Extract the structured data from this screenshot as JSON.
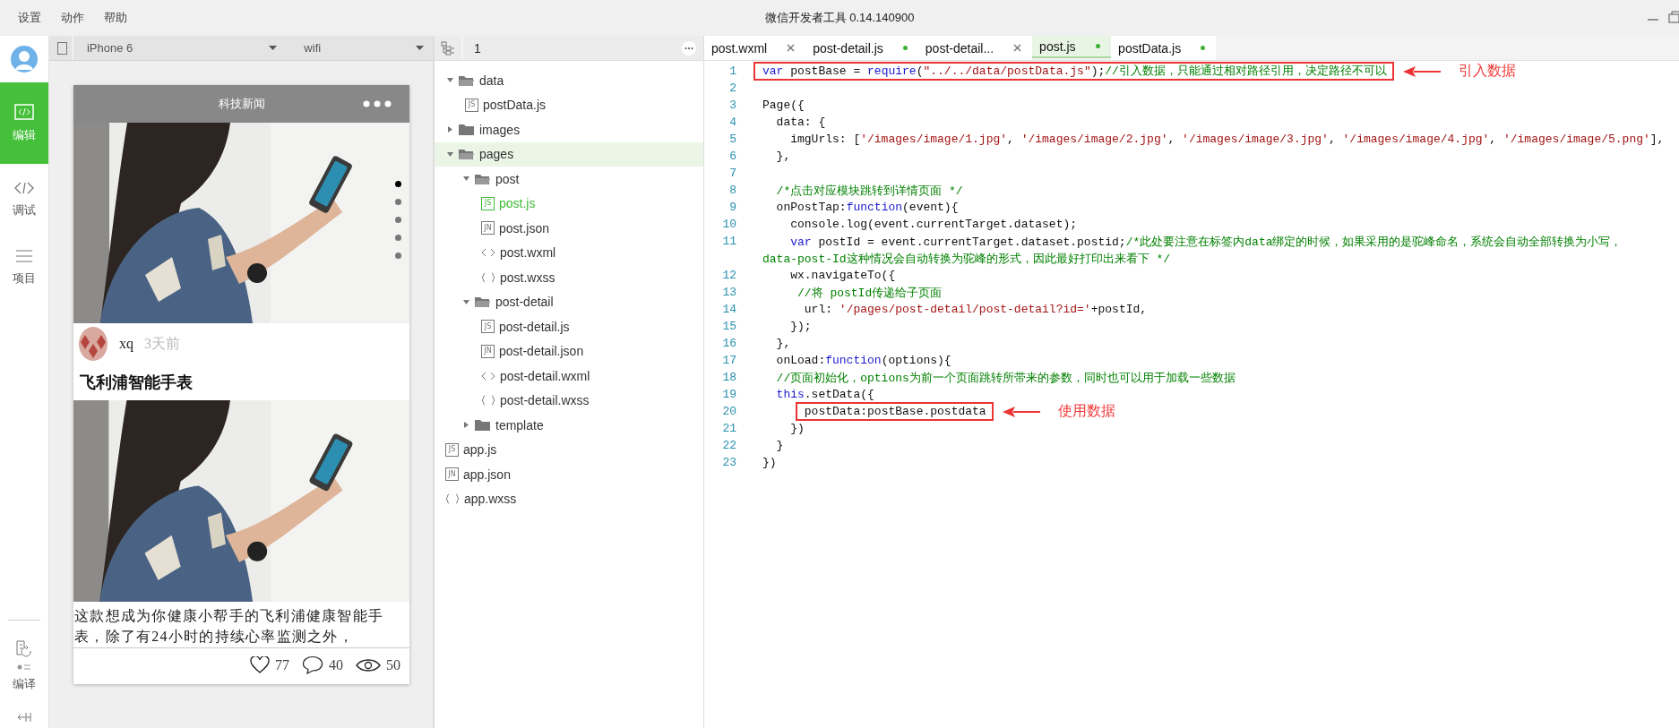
{
  "menu": [
    {
      "label": "设置"
    },
    {
      "label": "动作"
    },
    {
      "label": "帮助"
    }
  ],
  "window": {
    "title": "微信开发者工具 0.14.140900"
  },
  "sidebar": {
    "items": [
      {
        "label": "编辑",
        "kind": "edit",
        "selected": true
      },
      {
        "label": "调试",
        "kind": "debug",
        "selected": false
      },
      {
        "label": "项目",
        "kind": "project",
        "selected": false
      }
    ],
    "compile": {
      "label": "编译"
    }
  },
  "simulator": {
    "device": "iPhone 6",
    "network": "wifi",
    "nav_title": "科技新闻",
    "swiper_dots": [
      {
        "selected": true
      },
      {
        "selected": false
      },
      {
        "selected": false
      },
      {
        "selected": false
      },
      {
        "selected": false
      }
    ],
    "post": {
      "author": "xq",
      "date": "3天前",
      "title": "飞利浦智能手表",
      "content": "这款想成为你健康小帮手的飞利浦健康智能手表，除了有24小时的持续心率监测之外，",
      "likes": "77",
      "comments": "40",
      "views": "50"
    }
  },
  "file_tree": {
    "header": "1",
    "items": [
      {
        "name": "data",
        "kind": "folder",
        "expanded": true,
        "selected": false,
        "children": [
          {
            "name": "postData.js",
            "kind": "js",
            "badge": "JS",
            "open": false,
            "selected": false
          }
        ]
      },
      {
        "name": "images",
        "kind": "folder",
        "expanded": false,
        "selected": false
      },
      {
        "name": "pages",
        "kind": "folder",
        "expanded": true,
        "selected": true,
        "children": [
          {
            "name": "post",
            "kind": "folder",
            "expanded": true,
            "selected": false,
            "children": [
              {
                "name": "post.js",
                "kind": "js",
                "badge": "JS",
                "open": true,
                "selected": false
              },
              {
                "name": "post.json",
                "kind": "json",
                "badge": "JN",
                "open": false,
                "selected": false
              },
              {
                "name": "post.wxml",
                "kind": "wxml",
                "open": false,
                "selected": false
              },
              {
                "name": "post.wxss",
                "kind": "wxss",
                "open": false,
                "selected": false
              }
            ]
          },
          {
            "name": "post-detail",
            "kind": "folder",
            "expanded": true,
            "selected": false,
            "children": [
              {
                "name": "post-detail.js",
                "kind": "js",
                "badge": "JS",
                "open": false,
                "selected": false
              },
              {
                "name": "post-detail.json",
                "kind": "json",
                "badge": "JN",
                "open": false,
                "selected": false
              },
              {
                "name": "post-detail.wxml",
                "kind": "wxml",
                "open": false,
                "selected": false
              },
              {
                "name": "post-detail.wxss",
                "kind": "wxss",
                "open": false,
                "selected": false
              }
            ]
          },
          {
            "name": "template",
            "kind": "folder",
            "expanded": false,
            "selected": false
          }
        ]
      },
      {
        "name": "app.js",
        "kind": "js",
        "badge": "JS",
        "open": false,
        "selected": false
      },
      {
        "name": "app.json",
        "kind": "json",
        "badge": "JN",
        "open": false,
        "selected": false
      },
      {
        "name": "app.wxss",
        "kind": "wxss",
        "open": false,
        "selected": false
      }
    ]
  },
  "editor": {
    "tabs": [
      {
        "label": "post.wxml",
        "modified": false,
        "selected": false
      },
      {
        "label": "post-detail.js",
        "modified": true,
        "selected": false
      },
      {
        "label": "post-detail...",
        "modified": false,
        "selected": false
      },
      {
        "label": "post.js",
        "modified": true,
        "selected": true
      },
      {
        "label": "postData.js",
        "modified": true,
        "selected": false
      }
    ],
    "lines": [
      {
        "number": "1",
        "boxed": true,
        "annotation": "引入数据",
        "segments": [
          {
            "kind": "keyword",
            "text": "var"
          },
          {
            "kind": "plain",
            "text": " postBase = "
          },
          {
            "kind": "keyword",
            "text": "require"
          },
          {
            "kind": "plain",
            "text": "("
          },
          {
            "kind": "string",
            "text": "\"../../data/postData.js\""
          },
          {
            "kind": "plain",
            "text": ");"
          },
          {
            "kind": "comment",
            "text": "//引入数据，只能通过相对路径引用，决定路径不可以"
          }
        ]
      },
      {
        "number": "2"
      },
      {
        "number": "3",
        "boxed": false,
        "segments": [
          {
            "kind": "plain",
            "text": "Page({"
          }
        ]
      },
      {
        "number": "4",
        "boxed": false,
        "segments": [
          {
            "kind": "plain",
            "text": "  data: {"
          }
        ]
      },
      {
        "number": "5",
        "boxed": false,
        "segments": [
          {
            "kind": "plain",
            "text": "    imgUrls: ["
          },
          {
            "kind": "string",
            "text": "'/images/image/1.jpg'"
          },
          {
            "kind": "plain",
            "text": ", "
          },
          {
            "kind": "string",
            "text": "'/images/image/2.jpg'"
          },
          {
            "kind": "plain",
            "text": ", "
          },
          {
            "kind": "string",
            "text": "'/images/image/3.jpg'"
          },
          {
            "kind": "plain",
            "text": ", "
          },
          {
            "kind": "string",
            "text": "'/images/image/4.jpg'"
          },
          {
            "kind": "plain",
            "text": ", "
          },
          {
            "kind": "string",
            "text": "'/images/image/5.png'"
          },
          {
            "kind": "plain",
            "text": "],"
          }
        ]
      },
      {
        "number": "6",
        "boxed": false,
        "segments": [
          {
            "kind": "plain",
            "text": "  },"
          }
        ]
      },
      {
        "number": "7"
      },
      {
        "number": "8",
        "boxed": false,
        "segments": [
          {
            "kind": "comment",
            "text": "  /*点击对应模块跳转到详情页面 */"
          }
        ]
      },
      {
        "number": "9",
        "boxed": false,
        "segments": [
          {
            "kind": "plain",
            "text": "  onPostTap:"
          },
          {
            "kind": "keyword",
            "text": "function"
          },
          {
            "kind": "plain",
            "text": "(event){"
          }
        ]
      },
      {
        "number": "10",
        "boxed": false,
        "segments": [
          {
            "kind": "plain",
            "text": "    console.log(event.currentTarget.dataset);"
          }
        ]
      },
      {
        "number": "11",
        "boxed": false,
        "segments": [
          {
            "kind": "keyword",
            "text": "    var"
          },
          {
            "kind": "plain",
            "text": " postId = event.currentTarget.dataset.postid;"
          },
          {
            "kind": "comment",
            "text": "/*此处要注意在标签内data绑定的时候，如果采用的是驼峰命名，系统会自动全部转换为小写，"
          }
        ],
        "wrap": [
          {
            "kind": "comment",
            "text": "data-post-Id这种情况会自动转换为驼峰的形式，因此最好打印出来看下 */"
          }
        ]
      },
      {
        "number": "12",
        "boxed": false,
        "segments": [
          {
            "kind": "plain",
            "text": "    wx.navigateTo({"
          }
        ]
      },
      {
        "number": "13",
        "boxed": false,
        "segments": [
          {
            "kind": "comment",
            "text": "     //将 postId传递给子页面"
          }
        ]
      },
      {
        "number": "14",
        "boxed": false,
        "segments": [
          {
            "kind": "plain",
            "text": "      url: "
          },
          {
            "kind": "string",
            "text": "'/pages/post-detail/post-detail?id='"
          },
          {
            "kind": "plain",
            "text": "+postId,"
          }
        ]
      },
      {
        "number": "15",
        "boxed": false,
        "segments": [
          {
            "kind": "plain",
            "text": "    });"
          }
        ]
      },
      {
        "number": "16",
        "boxed": false,
        "segments": [
          {
            "kind": "plain",
            "text": "  },"
          }
        ]
      },
      {
        "number": "17",
        "boxed": false,
        "segments": [
          {
            "kind": "plain",
            "text": "  onLoad:"
          },
          {
            "kind": "keyword",
            "text": "function"
          },
          {
            "kind": "plain",
            "text": "(options){"
          }
        ]
      },
      {
        "number": "18",
        "boxed": false,
        "segments": [
          {
            "kind": "comment",
            "text": "  //页面初始化，options为前一个页面跳转所带来的参数，同时也可以用于加载一些数据"
          }
        ]
      },
      {
        "number": "19",
        "boxed": false,
        "segments": [
          {
            "kind": "keyword",
            "text": "  this"
          },
          {
            "kind": "plain",
            "text": ".setData({"
          }
        ]
      },
      {
        "number": "20",
        "boxed": true,
        "annotation": "使用数据",
        "segments": [
          {
            "kind": "plain",
            "text": "      postData:postBase.postdata"
          }
        ]
      },
      {
        "number": "21",
        "boxed": false,
        "segments": [
          {
            "kind": "plain",
            "text": "    })"
          }
        ]
      },
      {
        "number": "22",
        "boxed": false,
        "segments": [
          {
            "kind": "plain",
            "text": "  }"
          }
        ]
      },
      {
        "number": "23",
        "boxed": false,
        "segments": [
          {
            "kind": "plain",
            "text": "})"
          }
        ]
      }
    ]
  }
}
